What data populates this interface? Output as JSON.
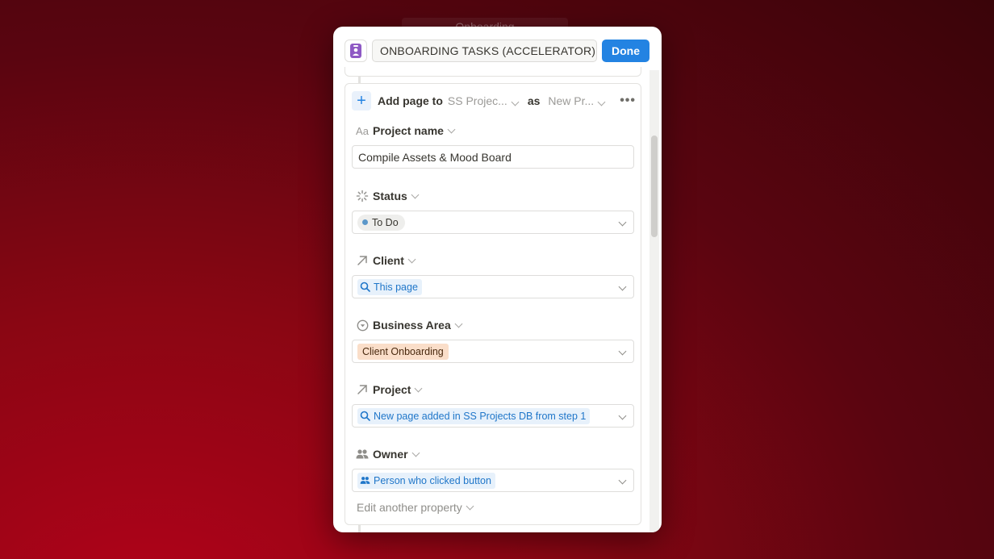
{
  "background": {
    "ghost_title": "Onboarding"
  },
  "header": {
    "title_value": "ONBOARDING TASKS (ACCELERATOR)",
    "done_label": "Done"
  },
  "action": {
    "prefix": "Add page to",
    "database": "SS Projec...",
    "as_label": "as",
    "template": "New Pr..."
  },
  "properties": {
    "project_name": {
      "label": "Project name",
      "icon": "text-aa-icon",
      "value": "Compile Assets & Mood Board"
    },
    "status": {
      "label": "Status",
      "icon": "status-spinner-icon",
      "value": "To Do",
      "dot_color": "#5b97c9"
    },
    "client": {
      "label": "Client",
      "icon": "relation-arrow-icon",
      "value": "This page"
    },
    "business_area": {
      "label": "Business Area",
      "icon": "select-circle-icon",
      "value": "Client Onboarding",
      "tag_color": "#fadec9"
    },
    "project": {
      "label": "Project",
      "icon": "relation-arrow-icon",
      "value": "New page added in SS Projects DB from step 1"
    },
    "owner": {
      "label": "Owner",
      "icon": "people-icon",
      "value": "Person who clicked button"
    }
  },
  "edit_another": "Edit another property",
  "colors": {
    "accent": "#2383e2",
    "background": "#8a0613"
  }
}
